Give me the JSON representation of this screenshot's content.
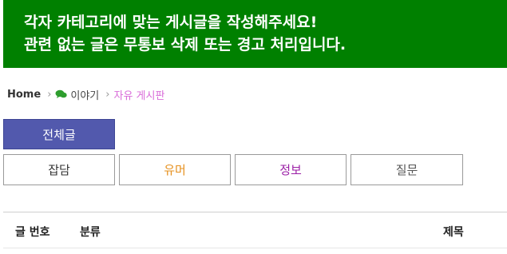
{
  "notice": {
    "line1": "각자 카테고리에 맞는 게시글을 작성해주세요!",
    "line2": "관련 없는 글은 무통보 삭제 또는 경고 처리입니다.",
    "background": "#008000"
  },
  "breadcrumb": {
    "home": "Home",
    "separator": "›",
    "board": "이야기",
    "board_icon": "chat-bubbles-icon",
    "current": "자유 게시판"
  },
  "tabs": {
    "all": {
      "label": "전체글",
      "color": "#ffffff"
    },
    "chat": {
      "label": "잡담",
      "color": "#333333"
    },
    "humor": {
      "label": "유머",
      "color": "#e6901e"
    },
    "info": {
      "label": "정보",
      "color": "#9b1fa6"
    },
    "question": {
      "label": "질문",
      "color": "#555555"
    }
  },
  "table": {
    "columns": {
      "number": "글 번호",
      "category": "분류",
      "title": "제목"
    }
  }
}
